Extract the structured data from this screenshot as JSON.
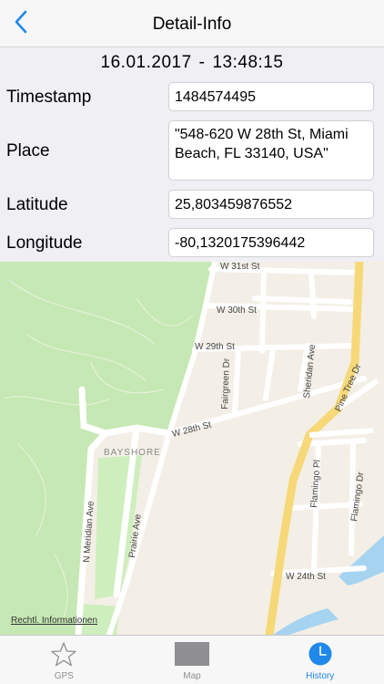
{
  "nav": {
    "title": "Detail-Info",
    "back_icon": "chevron-left-icon"
  },
  "datetime": {
    "date": "16.01.2017",
    "separator": "-",
    "time": "13:48:15"
  },
  "fields": {
    "timestamp": {
      "label": "Timestamp",
      "value": "1484574495"
    },
    "place": {
      "label": "Place",
      "value": "\"548-620 W 28th St, Miami Beach, FL 33140, USA\""
    },
    "latitude": {
      "label": "Latitude",
      "value": "25,803459876552"
    },
    "longitude": {
      "label": "Longitude",
      "value": "-80,1320175396442"
    }
  },
  "map": {
    "legal_link": "Rechtl. Informationen",
    "neighborhood": "BAYSHORE",
    "streets": [
      "W 31st St",
      "W 30th St",
      "W 29th St",
      "W 28th St",
      "W 24th St",
      "Fairgreen Dr",
      "Sheridan Ave",
      "Pine Tree Dr",
      "Flamingo Pl",
      "Flamingo Dr",
      "N Meridian Ave",
      "Prairie Ave"
    ],
    "colors": {
      "park": "#c6e8b4",
      "land": "#f3efe6",
      "road": "#ffffff",
      "major_road": "#f6d878",
      "water": "#a6d3f0"
    }
  },
  "tabs": [
    {
      "label": "GPS",
      "icon": "star-icon",
      "active": false
    },
    {
      "label": "Map",
      "icon": "map-icon",
      "active": false
    },
    {
      "label": "History",
      "icon": "clock-icon",
      "active": true
    }
  ],
  "colors": {
    "accent": "#1f88ea",
    "inactive": "#8e8e93"
  }
}
